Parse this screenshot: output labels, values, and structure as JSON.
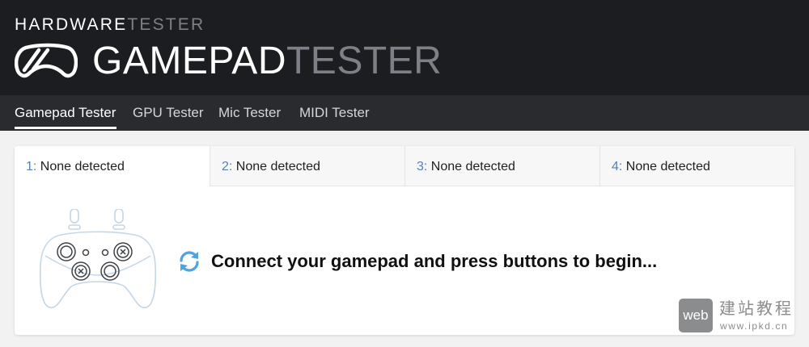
{
  "brand": {
    "top_white": "HARDWARE",
    "top_gray": "TESTER",
    "main_white": "GAMEPAD",
    "main_gray": "TESTER",
    "logo_icon": "gamepad-logo-icon"
  },
  "nav": {
    "items": [
      {
        "label": "Gamepad Tester",
        "active": true
      },
      {
        "label": "GPU Tester",
        "active": false
      },
      {
        "label": "Mic Tester",
        "active": false
      },
      {
        "label": "MIDI Tester",
        "active": false
      }
    ]
  },
  "tabs": [
    {
      "num": "1:",
      "label": "None detected",
      "active": true
    },
    {
      "num": "2:",
      "label": "None detected",
      "active": false
    },
    {
      "num": "3:",
      "label": "None detected",
      "active": false
    },
    {
      "num": "4:",
      "label": "None detected",
      "active": false
    }
  ],
  "main": {
    "prompt": "Connect your gamepad and press buttons to begin...",
    "refresh_icon": "refresh-icon",
    "illustration": "gamepad-outline-icon"
  },
  "watermark": {
    "box_text": "web",
    "title": "建站教程",
    "url": "www.ipkd.cn"
  },
  "colors": {
    "header_bg": "#1c1d21",
    "nav_bg": "#2a2b2f",
    "accent_blue": "#5a7fb5",
    "refresh_blue": "#4fa3e0"
  }
}
